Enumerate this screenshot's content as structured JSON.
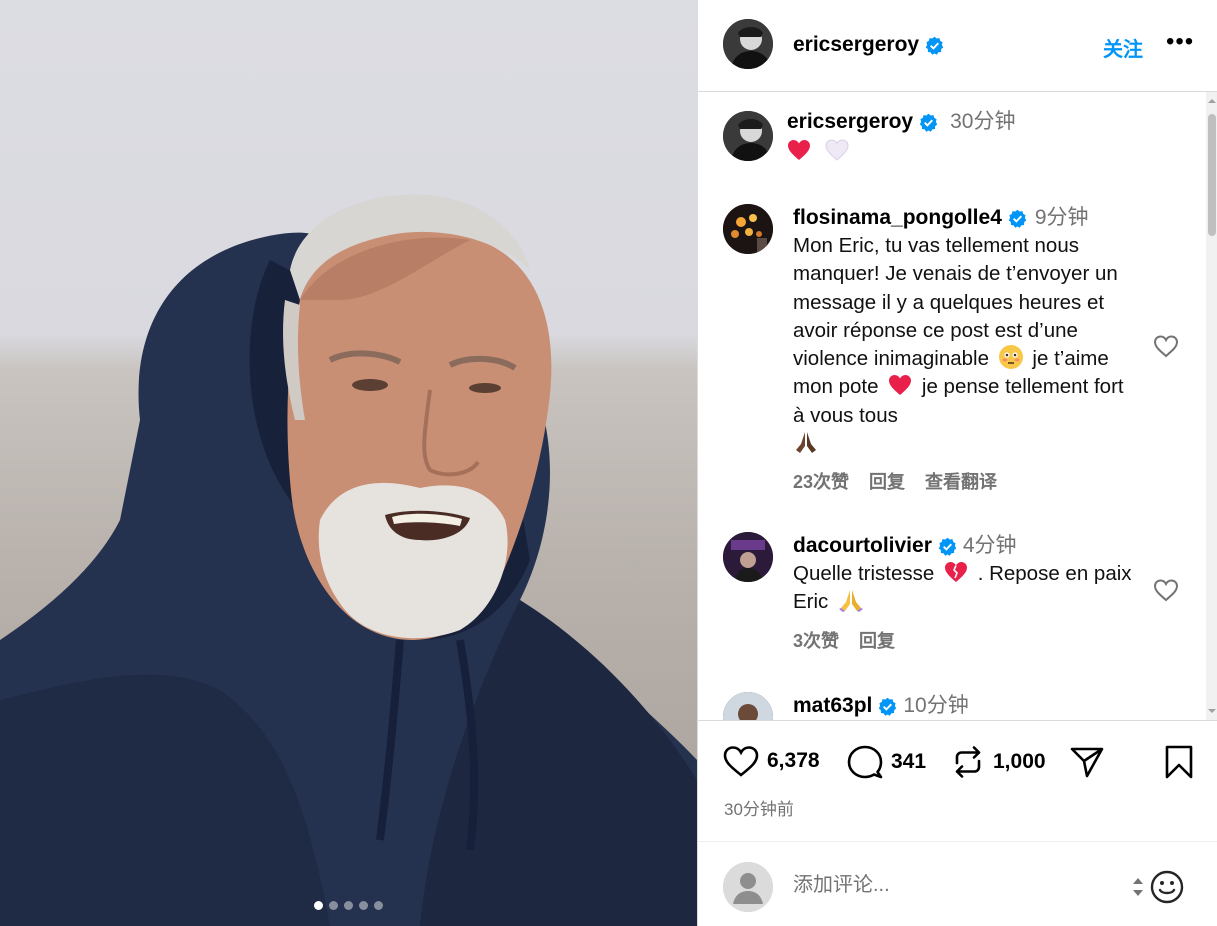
{
  "photo": {
    "slide_count": 5,
    "active_slide": 1
  },
  "post": {
    "username": "ericsergeroy",
    "follow_label": "关注",
    "more_label": "•••",
    "caption_time": "30分钟"
  },
  "comments": [
    {
      "username": "flosinama_pongolle4",
      "time": "9分钟",
      "text_parts": [
        "Mon Eric, tu vas tellement nous manquer! Je venais de t’envoyer un message il y a quelques heures et avoir réponse ce post est d’une violence inimaginable",
        "je t’aime mon pote",
        "je pense tellement fort à vous tous"
      ],
      "likes": "23次赞",
      "reply_label": "回复",
      "translate_label": "查看翻译"
    },
    {
      "username": "dacourtolivier",
      "time": "4分钟",
      "text_parts": [
        "Quelle tristesse",
        ". Repose en paix Eric"
      ],
      "likes": "3次赞",
      "reply_label": "回复"
    },
    {
      "username": "mat63pl",
      "time": "10分钟"
    }
  ],
  "actions": {
    "likes": "6,378",
    "comments": "341",
    "reposts": "1,000",
    "posted_ago": "30分钟前"
  },
  "comment_input": {
    "placeholder": "添加评论..."
  },
  "colors": {
    "accent": "#0095f6",
    "verified": "#0095f6",
    "heart_red": "#ff3040",
    "muted": "#737373"
  },
  "icons": [
    "verified-badge-icon",
    "more-icon",
    "heart-icon",
    "comment-icon",
    "repost-icon",
    "share-icon",
    "bookmark-icon",
    "emoji-icon",
    "sort-icon",
    "default-avatar-icon"
  ]
}
